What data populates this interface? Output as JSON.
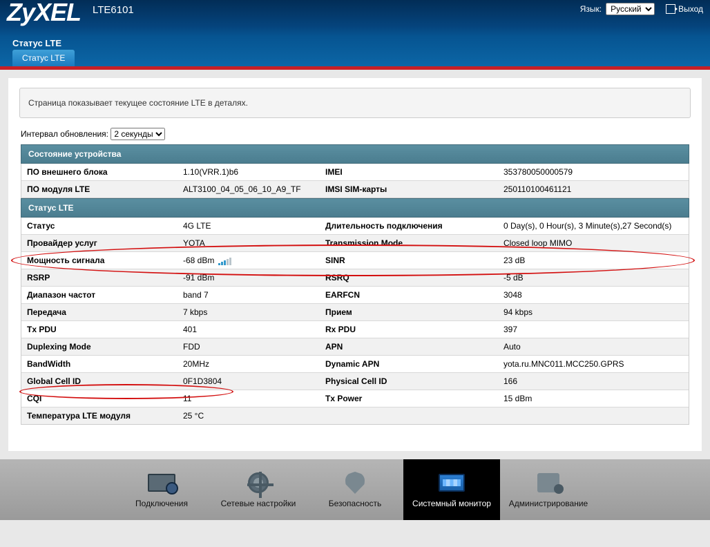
{
  "header": {
    "brand": "ZyXEL",
    "model": "LTE6101",
    "lang_label": "Язык:",
    "lang_selected": "Русский",
    "logout": "Выход"
  },
  "page": {
    "title": "Статус LTE",
    "tab": "Статус LTE",
    "banner": "Страница показывает текущее состояние LTE в деталях.",
    "refresh_label": "Интервал обновления:",
    "refresh_value": "2 секунды"
  },
  "sections": {
    "device": {
      "header": "Состояние устройства",
      "rows": [
        {
          "l1": "ПО внешнего блока",
          "v1": "1.10(VRR.1)b6",
          "l2": "IMEI",
          "v2": "353780050000579"
        },
        {
          "l1": "ПО модуля LTE",
          "v1": "ALT3100_04_05_06_10_A9_TF",
          "l2": "IMSI SIM-карты",
          "v2": "250110100461121"
        }
      ]
    },
    "lte": {
      "header": "Статус LTE",
      "rows": [
        {
          "l1": "Статус",
          "v1": "4G LTE",
          "l2": "Длительность подключения",
          "v2": "0 Day(s), 0 Hour(s), 3 Minute(s),27 Second(s)"
        },
        {
          "l1": "Провайдер услуг",
          "v1": "YOTA",
          "l2": "Transmission Mode",
          "v2": "Closed loop MIMO"
        },
        {
          "l1": "Мощность сигнала",
          "v1": "-68 dBm",
          "signal": true,
          "l2": "SINR",
          "v2": "23 dB"
        },
        {
          "l1": "RSRP",
          "v1": "-91 dBm",
          "l2": "RSRQ",
          "v2": "-5 dB"
        },
        {
          "l1": "Диапазон частот",
          "v1": "band 7",
          "l2": "EARFCN",
          "v2": "3048"
        },
        {
          "l1": "Передача",
          "v1": "7 kbps",
          "l2": "Прием",
          "v2": "94 kbps"
        },
        {
          "l1": "Tx PDU",
          "v1": "401",
          "l2": "Rx PDU",
          "v2": "397"
        },
        {
          "l1": "Duplexing Mode",
          "v1": "FDD",
          "l2": "APN",
          "v2": "Auto"
        },
        {
          "l1": "BandWidth",
          "v1": "20MHz",
          "l2": "Dynamic APN",
          "v2": "yota.ru.MNC011.MCC250.GPRS"
        },
        {
          "l1": "Global Cell ID",
          "v1": "0F1D3804",
          "l2": "Physical Cell ID",
          "v2": "166"
        },
        {
          "l1": "CQI",
          "v1": "11",
          "l2": "Tx Power",
          "v2": "15 dBm"
        },
        {
          "l1": "Температура LTE модуля",
          "v1": "25 °C",
          "l2": "",
          "v2": ""
        }
      ]
    }
  },
  "nav": {
    "items": [
      {
        "label": "Подключения"
      },
      {
        "label": "Сетевые настройки"
      },
      {
        "label": "Безопасность"
      },
      {
        "label": "Системный монитор",
        "active": true
      },
      {
        "label": "Администрирование"
      }
    ]
  }
}
